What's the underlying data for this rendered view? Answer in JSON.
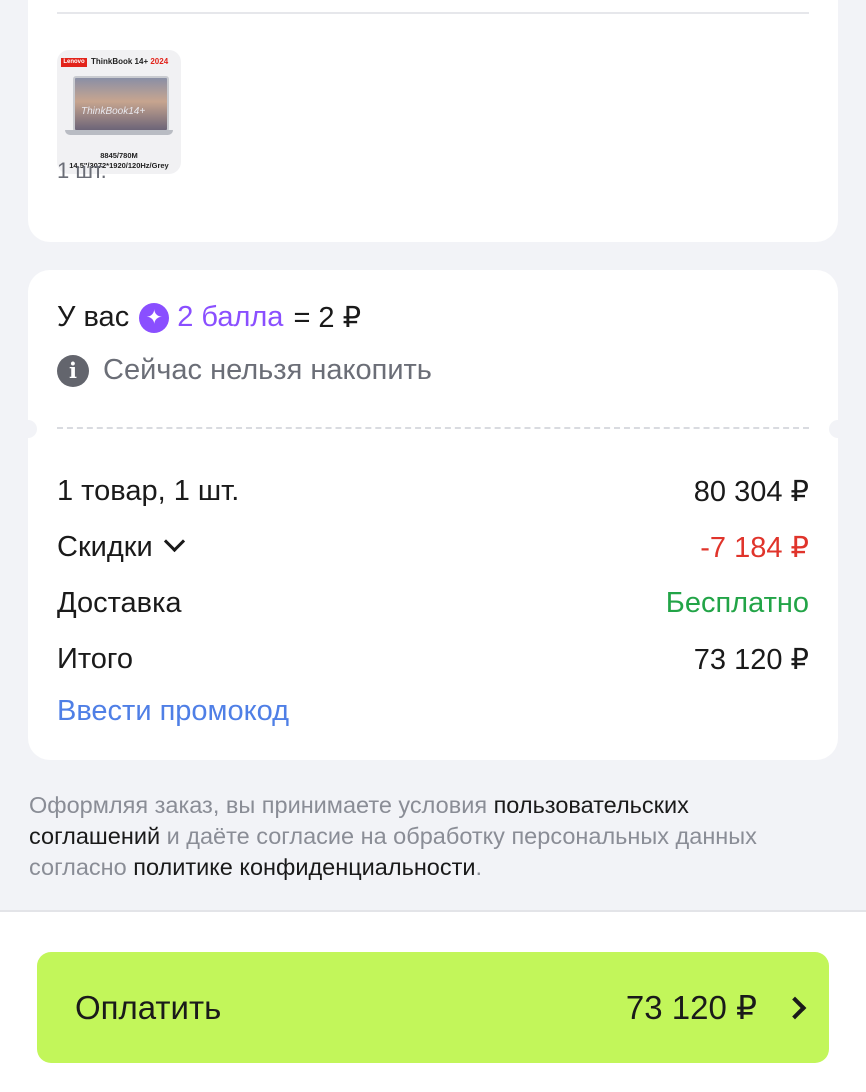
{
  "product": {
    "thumbnail": {
      "brand": "Lenovo",
      "model": "ThinkBook 14+",
      "year": "2024",
      "screen_text": "ThinkBook14+",
      "spec_line1": "8845/780M",
      "spec_line2": "14.5\"/3072*1920/120Hz/Grey"
    },
    "quantity": "1 шт."
  },
  "bonus": {
    "prefix": "У вас",
    "points": "2 балла",
    "equals": "= 2 ₽",
    "notice": "Сейчас нельзя накопить"
  },
  "summary": {
    "items_label": "1 товар, 1 шт.",
    "items_value": "80 304 ₽",
    "discount_label": "Скидки",
    "discount_value": "-7 184 ₽",
    "delivery_label": "Доставка",
    "delivery_value": "Бесплатно",
    "total_label": "Итого",
    "total_value": "73 120 ₽",
    "promo_link": "Ввести промокод"
  },
  "legal": {
    "part1": "Оформляя заказ, вы принимаете условия ",
    "link1": "пользовательских соглашений",
    "part2": " и даёте согласие на обработку персональных данных согласно ",
    "link2": "политике конфиденциальности",
    "part3": "."
  },
  "pay_button": {
    "label": "Оплатить",
    "amount": "73 120 ₽"
  },
  "colors": {
    "accent_purple": "#8a4fff",
    "discount_red": "#e0342b",
    "delivery_green": "#22a447",
    "link_blue": "#4f7fe6",
    "pay_button_bg": "#c2f65a"
  }
}
